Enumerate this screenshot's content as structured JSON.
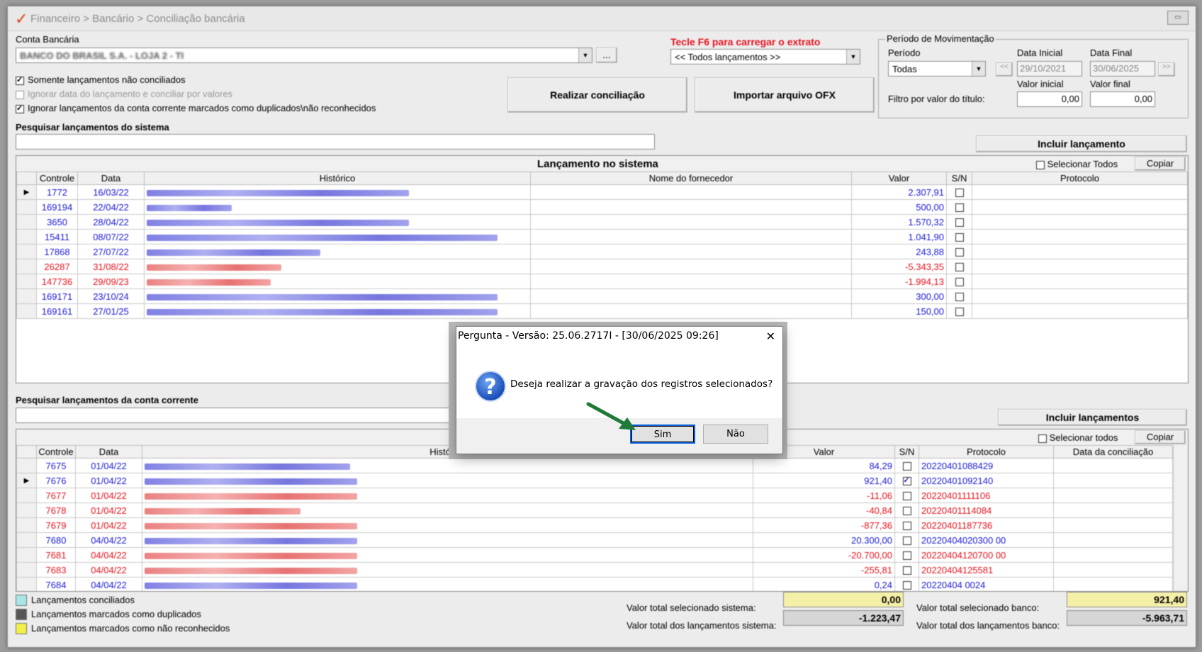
{
  "window": {
    "breadcrumb": "Financeiro > Bancário > Conciliação bancária"
  },
  "top": {
    "conta_label": "Conta Bancária",
    "conta_value": "BANCO DO BRASIL S.A. - LOJA 2 - TI",
    "f6_label": "Tecle F6 para carregar o extrato",
    "extrato_value": "<< Todos lançamentos >>",
    "ellipsis": "...",
    "chk1": "Somente lançamentos não conciliados",
    "chk2": "Ignorar data do lançamento e conciliar por valores",
    "chk3": "Ignorar lançamentos da conta corrente marcados como duplicados\\não reconhecidos",
    "btn_conciliar": "Realizar conciliação",
    "btn_ofx": "Importar arquivo OFX"
  },
  "periodo": {
    "group_label": "Período de Movimentação",
    "periodo_label": "Período",
    "periodo_value": "Todas",
    "data_inicial_label": "Data Inicial",
    "data_inicial": "29/10/2021",
    "data_final_label": "Data Final",
    "data_final": "30/06/2025",
    "valor_inicial_label": "Valor inicial",
    "valor_final_label": "Valor final",
    "filtro_label": "Filtro por valor do título:",
    "valor_inicial": "0,00",
    "valor_final": "0,00",
    "prev": "<<",
    "next": ">>"
  },
  "sistema": {
    "search_label": "Pesquisar lançamentos do sistema",
    "incluir": "Incluir lançamento",
    "grid_title": "Lançamento no sistema",
    "selecionar_todos": "Selecionar Todos",
    "copiar": "Copiar",
    "columns": [
      "Controle",
      "Data",
      "Histórico",
      "Nome do fornecedor",
      "Valor",
      "S/N",
      "Protocolo"
    ],
    "rows": [
      {
        "controle": "1772",
        "data": "16/03/22",
        "valor": "2.307,91",
        "color": "blue",
        "w": 370,
        "sel": true
      },
      {
        "controle": "169194",
        "data": "22/04/22",
        "valor": "500,00",
        "color": "blue",
        "w": 120
      },
      {
        "controle": "3650",
        "data": "28/04/22",
        "valor": "1.570,32",
        "color": "blue",
        "w": 370
      },
      {
        "controle": "15411",
        "data": "08/07/22",
        "valor": "1.041,90",
        "color": "blue",
        "w": 495
      },
      {
        "controle": "17868",
        "data": "27/07/22",
        "valor": "243,88",
        "color": "blue",
        "w": 245
      },
      {
        "controle": "26287",
        "data": "31/08/22",
        "valor": "-5.343,35",
        "color": "red",
        "w": 190
      },
      {
        "controle": "147736",
        "data": "29/09/23",
        "valor": "-1.994,13",
        "color": "red",
        "w": 175
      },
      {
        "controle": "169171",
        "data": "23/10/24",
        "valor": "300,00",
        "color": "blue",
        "w": 495
      },
      {
        "controle": "169161",
        "data": "27/01/25",
        "valor": "150,00",
        "color": "blue",
        "w": 495
      }
    ]
  },
  "banco": {
    "search_label": "Pesquisar lançamentos da conta corrente",
    "incluir": "Incluir lançamentos",
    "selecionar_todos": "Selecionar todos",
    "copiar": "Copiar",
    "columns": [
      "Controle",
      "Data",
      "Histórico",
      "Valor",
      "S/N",
      "Protocolo",
      "Data da conciliação"
    ],
    "rows": [
      {
        "controle": "7675",
        "data": "01/04/22",
        "valor": "84,29",
        "protocolo": "20220401088429",
        "color": "blue",
        "w": 290,
        "checked": false
      },
      {
        "controle": "7676",
        "data": "01/04/22",
        "valor": "921,40",
        "protocolo": "20220401092140",
        "color": "blue",
        "w": 300,
        "checked": true,
        "sel": true
      },
      {
        "controle": "7677",
        "data": "01/04/22",
        "valor": "-11,06",
        "protocolo": "20220401111106",
        "color": "red",
        "w": 300,
        "checked": false
      },
      {
        "controle": "7678",
        "data": "01/04/22",
        "valor": "-40,84",
        "protocolo": "20220401114084",
        "color": "red",
        "w": 220,
        "checked": false
      },
      {
        "controle": "7679",
        "data": "01/04/22",
        "valor": "-877,36",
        "protocolo": "20220401187736",
        "color": "red",
        "w": 300,
        "checked": false
      },
      {
        "controle": "7680",
        "data": "04/04/22",
        "valor": "20.300,00",
        "protocolo": "20220404020300 00",
        "color": "blue",
        "w": 300,
        "checked": false
      },
      {
        "controle": "7681",
        "data": "04/04/22",
        "valor": "-20.700,00",
        "protocolo": "20220404120700 00",
        "color": "red",
        "w": 300,
        "checked": false
      },
      {
        "controle": "7683",
        "data": "04/04/22",
        "valor": "-255,81",
        "protocolo": "20220404125581",
        "color": "red",
        "w": 300,
        "checked": false
      },
      {
        "controle": "7684",
        "data": "04/04/22",
        "valor": "0,24",
        "protocolo": "20220404 0024",
        "color": "blue",
        "w": 300,
        "checked": false
      }
    ]
  },
  "legend": {
    "conciliados": "Lançamentos conciliados",
    "duplicados": "Lançamentos marcados como duplicados",
    "nao_reconhecidos": "Lançamentos marcados como não reconhecidos",
    "colors": {
      "conciliados": "#a8e6e6",
      "duplicados": "#555555",
      "nao_reconhecidos": "#f2ee4a"
    }
  },
  "totals": {
    "sel_sistema_label": "Valor total selecionado sistema:",
    "sel_sistema": "0,00",
    "tot_sistema_label": "Valor total dos lançamentos sistema:",
    "tot_sistema": "-1.223,47",
    "sel_banco_label": "Valor total selecionado banco:",
    "sel_banco": "921,40",
    "tot_banco_label": "Valor total dos lançamentos banco:",
    "tot_banco": "-5.963,71"
  },
  "dialog": {
    "title": "Pergunta - Versão: 25.06.2717I - [30/06/2025 09:26]",
    "message": "Deseja realizar a gravação dos registros selecionados?",
    "yes": "Sim",
    "no": "Não",
    "icon": "?"
  }
}
